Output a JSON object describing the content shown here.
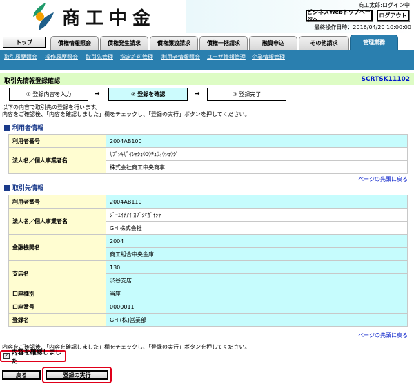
{
  "header": {
    "logo_text": "商工中金",
    "user_status": "商工太郎:ログイン中",
    "bizweb_button": "ビジネスWebトップページへ",
    "logout_button": "ログアウト",
    "last_operation": "最終操作日時：2016/04/20 10:00:00",
    "logo_colors": {
      "leaf_green": "#1f9a6a",
      "leaf_blue": "#1f5f8a",
      "dot_orange": "#f5a000"
    }
  },
  "tabs": [
    {
      "label": "トップ"
    },
    {
      "label": "債権情報照会"
    },
    {
      "label": "債権発生請求"
    },
    {
      "label": "債権譲渡請求"
    },
    {
      "label": "債権一括請求"
    },
    {
      "label": "融資申込"
    },
    {
      "label": "その他請求"
    },
    {
      "label": "管理業務",
      "active": true
    }
  ],
  "subnav": [
    {
      "label": "取引履歴照会"
    },
    {
      "label": "操作履歴照会"
    },
    {
      "label": "取引先管理"
    },
    {
      "label": "指定許可管理"
    },
    {
      "label": "利用者情報照会"
    },
    {
      "label": "ユーザ情報管理"
    },
    {
      "label": "企業情報管理"
    }
  ],
  "page": {
    "title": "取引先情報登録確認",
    "screen_id": "SCRTSK11102"
  },
  "steps": [
    {
      "label": "① 登録内容を入力"
    },
    {
      "label": "② 登録を確認",
      "current": true
    },
    {
      "label": "③ 登録完了"
    }
  ],
  "step_arrow": "➡",
  "intro": {
    "line1": "以下の内容で取引先の登録を行います。",
    "line2": "内容をご確認後、「内容を確認しました」欄をチェックし、「登録の実行」ボタンを押してください。"
  },
  "user_section": {
    "heading": "利用者情報",
    "rows": {
      "user_no_label": "利用者番号",
      "user_no": "2004AB100",
      "name_label": "法人名／個人事業者名",
      "name_kana": "ｶﾌﾞｼｷｶﾞｲｼｬｼｮｳｺｳﾁｭｳｵｳｼｮｳｼﾞ",
      "name": "株式会社商工中央商事"
    }
  },
  "partner_section": {
    "heading": "取引先情報",
    "rows": {
      "user_no_label": "利用者番号",
      "user_no": "2004AB110",
      "name_label": "法人名／個人事業者名",
      "name_kana": "ｼﾞｰｴｲﾁｱｲ ｶﾌﾞｼｷｶﾞｲｼｬ",
      "name": "GHI株式会社",
      "bank_label": "金融機関名",
      "bank_code": "2004",
      "bank_name": "商工組合中央金庫",
      "branch_label": "支店名",
      "branch_code": "130",
      "branch_name": "渋谷支店",
      "acct_type_label": "口座種別",
      "acct_type": "当座",
      "acct_no_label": "口座番号",
      "acct_no": "0000011",
      "reg_name_label": "登録名",
      "reg_name": "GHI(株)営業部"
    }
  },
  "back_to_top": "ページの先頭に戻る",
  "footer": {
    "note": "内容をご確認後、「内容を確認しました」欄をチェックし、「登録の実行」ボタンを押してください。",
    "confirm_label": "内容を確認しました",
    "confirm_checked": true,
    "back_button": "戻る",
    "execute_button": "登録の実行"
  }
}
